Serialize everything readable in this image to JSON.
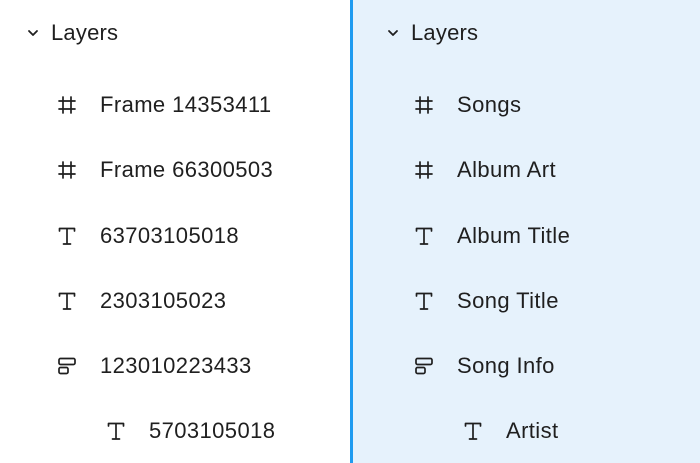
{
  "left_panel": {
    "title": "Layers",
    "items": [
      {
        "icon": "frame-icon",
        "label": "Frame 14353411"
      },
      {
        "icon": "frame-icon",
        "label": "Frame 66300503"
      },
      {
        "icon": "text-icon",
        "label": "63703105018"
      },
      {
        "icon": "text-icon",
        "label": "2303105023"
      },
      {
        "icon": "auto-layout-icon",
        "label": "123010223433"
      },
      {
        "icon": "text-icon",
        "label": "5703105018"
      }
    ]
  },
  "right_panel": {
    "title": "Layers",
    "items": [
      {
        "icon": "frame-icon",
        "label": "Songs"
      },
      {
        "icon": "frame-icon",
        "label": "Album Art"
      },
      {
        "icon": "text-icon",
        "label": "Album Title"
      },
      {
        "icon": "text-icon",
        "label": "Song Title"
      },
      {
        "icon": "auto-layout-icon",
        "label": "Song Info"
      },
      {
        "icon": "text-icon",
        "label": "Artist"
      }
    ]
  },
  "colors": {
    "selected_panel_bg": "#e6f2fc",
    "selection_accent": "#1f9bf0",
    "text": "#1f1f1f"
  }
}
